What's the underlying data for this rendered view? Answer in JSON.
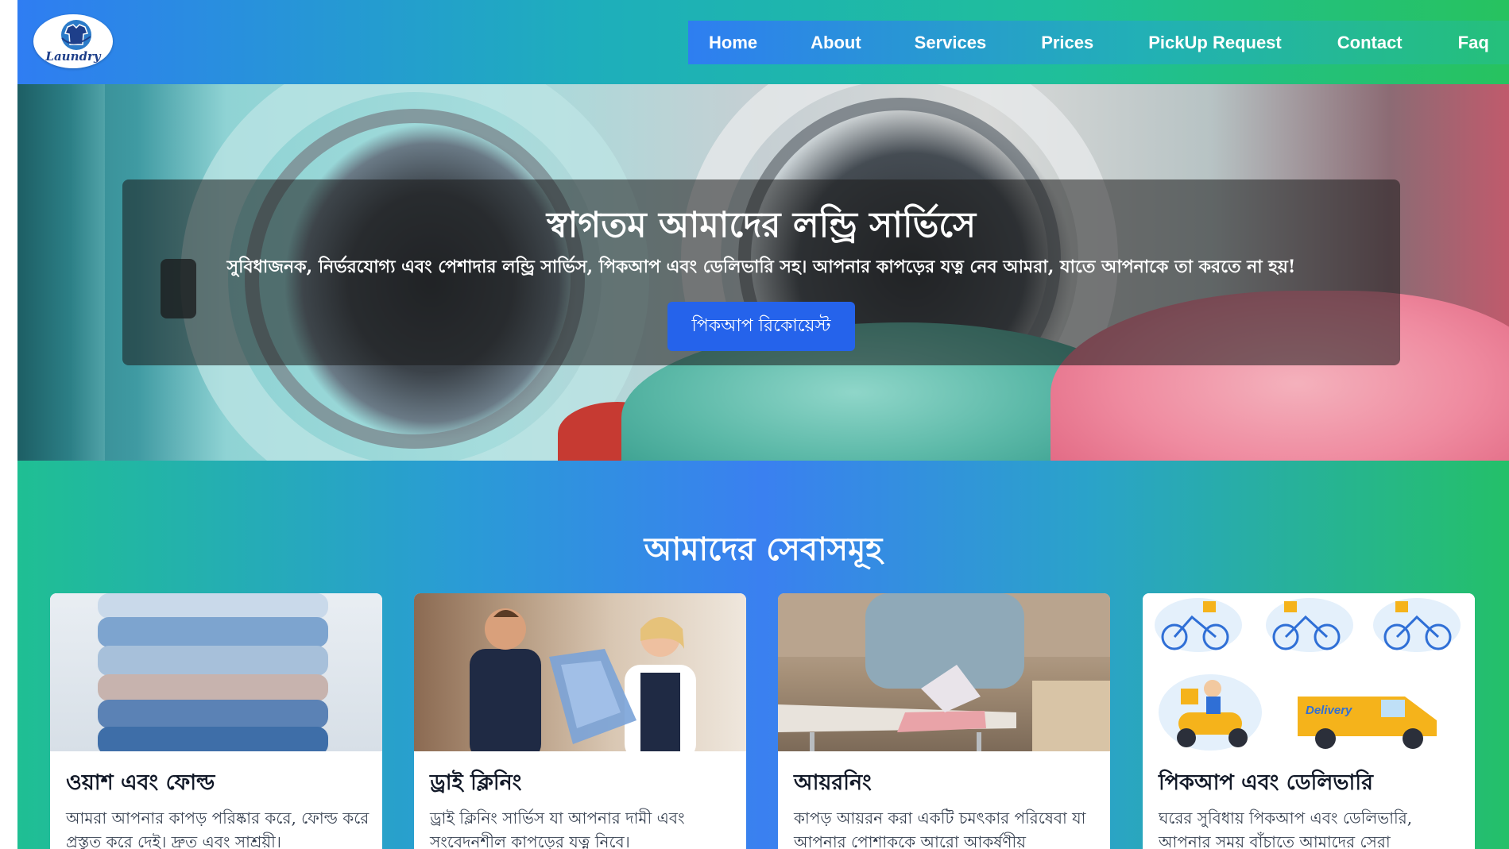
{
  "header": {
    "logo_text": "Laundry",
    "nav": [
      "Home",
      "About",
      "Services",
      "Prices",
      "PickUp Request",
      "Contact",
      "Faq"
    ]
  },
  "hero": {
    "title": "স্বাগতম আমাদের লন্ড্রি সার্ভিসে",
    "subtitle": "সুবিধাজনক, নির্ভরযোগ্য এবং পেশাদার লন্ড্রি সার্ভিস, পিকআপ এবং ডেলিভারি সহ। আপনার কাপড়ের যত্ন নেব আমরা, যাতে আপনাকে তা করতে না হয়!",
    "button": "পিকআপ রিকোয়েস্ট"
  },
  "services": {
    "title": "আমাদের সেবাসমূহ",
    "cards": [
      {
        "title": "ওয়াশ এবং ফোল্ড",
        "desc": "আমরা আপনার কাপড় পরিষ্কার করে, ফোল্ড করে প্রস্তুত করে দেই। দ্রুত এবং সাশ্রয়ী।",
        "icon": "folded-clothes-image"
      },
      {
        "title": "ড্রাই ক্লিনিং",
        "desc": "ড্রাই ক্লিনিং সার্ভিস যা আপনার দামী এবং সংবেদনশীল কাপড়ের যত্ন নিবে।",
        "icon": "dry-cleaning-image"
      },
      {
        "title": "আয়রনিং",
        "desc": "কাপড় আয়রন করা একটি চমৎকার পরিষেবা যা আপনার পোশাককে আরো আকর্ষণীয়",
        "icon": "ironing-image"
      },
      {
        "title": "পিকআপ এবং ডেলিভারি",
        "desc": "ঘরের সুবিধায় পিকআপ এবং ডেলিভারি, আপনার সময় বাঁচাতে আমাদের সেরা",
        "icon": "delivery-illustration",
        "van_label": "Delivery"
      }
    ]
  },
  "colors": {
    "accent_blue": "#2563eb",
    "header_gradient_start": "#2f7df2",
    "header_gradient_end": "#27c25f"
  }
}
